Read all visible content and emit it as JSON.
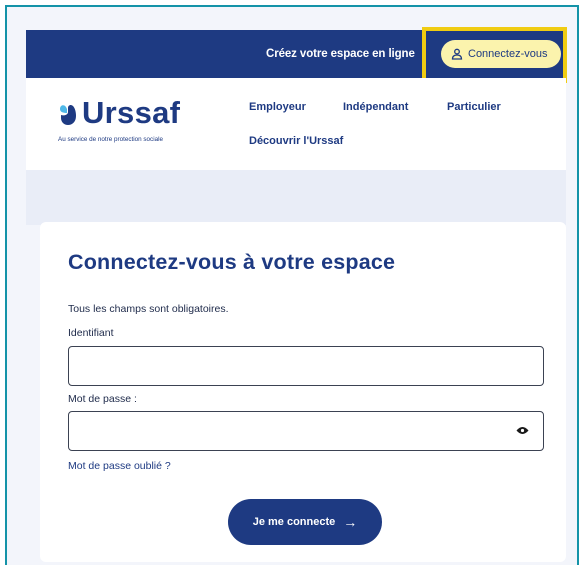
{
  "topbar": {
    "create_space_link": "Créez votre espace en ligne",
    "connect_button": "Connectez-vous"
  },
  "header": {
    "logo_name": "Urssaf",
    "logo_tagline": "Au service de notre protection sociale",
    "nav": [
      "Employeur",
      "Indépendant",
      "Particulier",
      "Découvrir l'Urssaf"
    ]
  },
  "login": {
    "title": "Connectez-vous à votre espace",
    "required_note": "Tous les champs sont obligatoires.",
    "identifier_label": "Identifiant",
    "identifier_value": "",
    "password_label": "Mot de passe :",
    "password_value": "",
    "forgot_link": "Mot de passe oublié ?",
    "submit_label": "Je me connecte",
    "submit_arrow": "→"
  },
  "colors": {
    "brand_navy": "#1e3a82",
    "highlight_yellow": "#f0cc12",
    "pill_yellow": "#fbf3ad",
    "frame_teal": "#1493a8",
    "logo_light_blue": "#4fb8e8"
  },
  "icons": [
    "user-icon",
    "urssaf-logo-icon",
    "eye-icon",
    "arrow-right-icon"
  ]
}
